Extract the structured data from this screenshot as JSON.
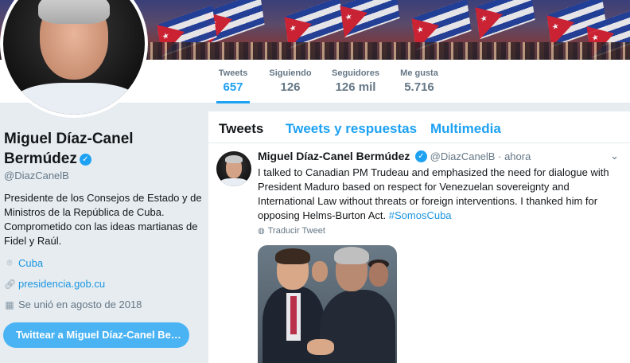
{
  "profile": {
    "name": "Miguel Díaz-Canel Bermúdez",
    "handle": "@DiazCanelB",
    "bio": "Presidente de los Consejos de Estado y de Ministros de la República de Cuba. Comprometido con las ideas martianas de Fidel y Raúl.",
    "location": "Cuba",
    "website": "presidencia.gob.cu",
    "joined": "Se unió en agosto de 2018",
    "tweet_to_button": "Twittear a Miguel Díaz-Canel Be…",
    "verified": true
  },
  "stats": [
    {
      "label": "Tweets",
      "value": "657",
      "active": true
    },
    {
      "label": "Siguiendo",
      "value": "126",
      "active": false
    },
    {
      "label": "Seguidores",
      "value": "126 mil",
      "active": false
    },
    {
      "label": "Me gusta",
      "value": "5.716",
      "active": false
    }
  ],
  "timeline": {
    "tabs": [
      {
        "label": "Tweets",
        "active": true
      },
      {
        "label": "Tweets y respuestas",
        "active": false
      },
      {
        "label": "Multimedia",
        "active": false
      }
    ]
  },
  "tweet": {
    "name": "Miguel Díaz-Canel Bermúdez",
    "handle": "@DiazCanelB",
    "separator": "·",
    "time": "ahora",
    "text": "I  talked to Canadian PM Trudeau and emphasized the need for dialogue with President Maduro based on respect for Venezuelan sovereignty and International Law without threats or foreign interventions. I thanked him for opposing Helms-Burton Act.",
    "hashtag": "#SomosCuba",
    "translate_label": "Traducir Tweet"
  },
  "colors": {
    "accent": "#1da1f2",
    "link": "#1b95e0",
    "muted": "#657786",
    "background": "#e6ecf0"
  },
  "icons": {
    "location": "location-pin-icon",
    "link": "link-icon",
    "calendar": "calendar-icon",
    "verified": "verified-badge-icon",
    "chevron": "chevron-down-icon",
    "globe": "globe-icon"
  }
}
